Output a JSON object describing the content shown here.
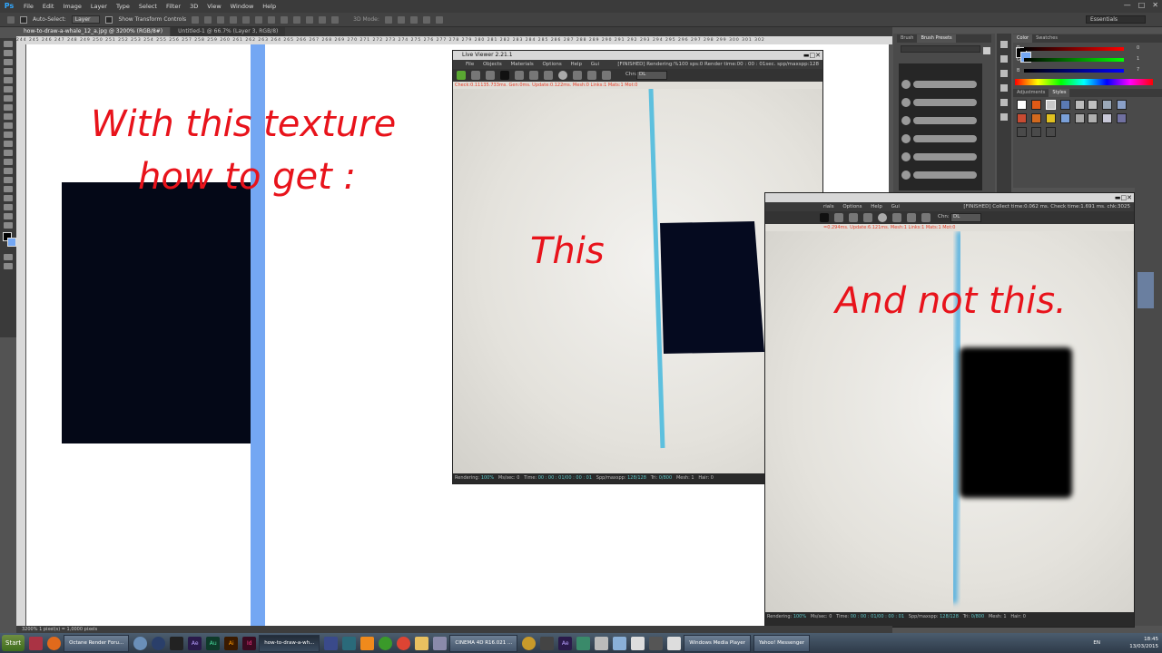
{
  "app": {
    "logo": "Ps",
    "menu": [
      "File",
      "Edit",
      "Image",
      "Layer",
      "Type",
      "Select",
      "Filter",
      "3D",
      "View",
      "Window",
      "Help"
    ],
    "options_bar": {
      "auto_select_label": "Auto-Select:",
      "auto_select_value": "Layer",
      "transform_label": "Show Transform Controls",
      "mode_label": "3D Mode:"
    },
    "workspace": "Essentials"
  },
  "doc_tabs": [
    {
      "label": "how-to-draw-a-whale_12_a.jpg @ 3200% (RGB/8#)",
      "active": true
    },
    {
      "label": "Untitled-1 @ 66.7% (Layer 3, RGB/8)",
      "active": false
    }
  ],
  "ruler_text": "244 245 246 247 248 249 250 251 252 253 254 255 256 257 258 259 260 261 262 263 264 265 266 267 268 269 270 271 272 273 274 275 276 277 278 279 280 281 282 283 284 285 286 287 288 289 290 291 292 293 294 295 296 297 298 299 300 301 302",
  "canvas_text": {
    "line1": "With this texture",
    "line2": "how to get :",
    "this": "This",
    "not_this": "And not this."
  },
  "panels": {
    "brush_tabs": [
      "Brush",
      "Brush Presets"
    ],
    "color_tabs": [
      "Color",
      "Swatches"
    ],
    "color_values": {
      "R": "0",
      "G": "1",
      "B": "7"
    },
    "style_tabs": [
      "Adjustments",
      "Styles"
    ]
  },
  "live_viewer_1": {
    "title": "Live Viewer 2.21.1",
    "menu": [
      "File",
      "Objects",
      "Materials",
      "Options",
      "Help",
      "Gui"
    ],
    "state": "[FINISHED]  Rendering:%100 sps:0 Render time:00 : 00 : 01sec. spp/maxspp:128",
    "channel_label": "Chn:",
    "channel_value": "DL",
    "info": "Check:0.11135.733ms. Gen:0ms. Update:0.122ms. Mesh:0 Links:1 Mats:1 Mot:0",
    "status": {
      "rendering_label": "Rendering:",
      "rendering_value": "100%",
      "mssec": "Ms/sec: 0",
      "time_label": "Time:",
      "time_value": "00 : 00 : 01/00 : 00 : 01",
      "spp_label": "Spp/maxspp:",
      "spp_value": "128/128",
      "tri_label": "Tri:",
      "tri_value": "0/800",
      "mesh": "Mesh: 1",
      "hair": "Hair: 0"
    }
  },
  "live_viewer_2": {
    "menu": [
      "rials",
      "Options",
      "Help",
      "Gui"
    ],
    "state": "[FINISHED] Collect time:0.062 ms.  Check time:1.691 ms.  chk:3025",
    "channel_label": "Chn:",
    "channel_value": "DL",
    "info": "=0.294ms. Update:6.121ms. Mesh:1 Links:1 Mats:1 Mot:0",
    "status": {
      "rendering_label": "Rendering:",
      "rendering_value": "100%",
      "mssec": "Ms/sec: 0",
      "time_label": "Time:",
      "time_value": "00 : 00 : 01/00 : 00 : 01",
      "spp_label": "Spp/maxspp:",
      "spp_value": "128/128",
      "tri_label": "Tri:",
      "tri_value": "0/800",
      "mesh": "Mesh: 1",
      "hair": "Hair: 0"
    }
  },
  "doc_status": "3200%        1 pixel(s) = 1,0000 pixels",
  "taskbar": {
    "start": "Start",
    "buttons": [
      {
        "label": "Octane Render Foru...",
        "active": false
      },
      {
        "label": "how-to-draw-a-wh...",
        "active": true
      },
      {
        "label": "CINEMA 4D R16.021 ...",
        "active": false
      },
      {
        "label": "Windows Media Player",
        "active": false
      },
      {
        "label": "Yahoo! Messenger",
        "active": false
      }
    ],
    "app_icons": [
      "Ae",
      "Au",
      "Ai",
      "Id",
      "Ae"
    ],
    "lang": "EN",
    "time": "18:45",
    "date": "13/03/2015"
  },
  "colors": {
    "accent_red": "#e8131b",
    "blue_bar": "#74a7f3",
    "dark_rect": "#040817",
    "render_line": "#5ec0de"
  }
}
